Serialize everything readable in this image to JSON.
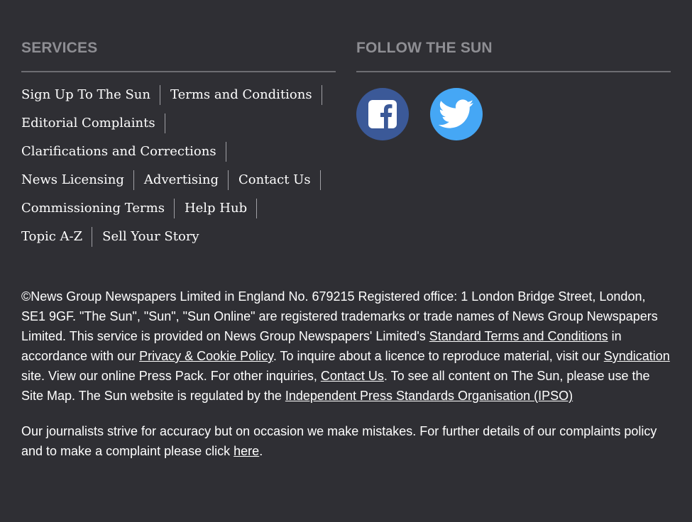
{
  "services": {
    "title": "SERVICES",
    "links": [
      "Sign Up To The Sun",
      "Terms and Conditions",
      "Editorial Complaints",
      "Clarifications and Corrections",
      "News Licensing",
      "Advertising",
      "Contact Us",
      "Commissioning Terms",
      "Help Hub",
      "Topic A-Z",
      "Sell Your Story"
    ]
  },
  "follow": {
    "title": "FOLLOW THE SUN",
    "facebook_icon": "facebook-icon",
    "twitter_icon": "twitter-icon",
    "facebook_color": "#3b5998",
    "twitter_color": "#45a7f5"
  },
  "legal": {
    "p1_part1": "©News Group Newspapers Limited in England No. 679215 Registered office: 1 London Bridge Street, London, SE1 9GF. \"The Sun\", \"Sun\", \"Sun Online\" are registered trademarks or trade names of News Group Newspapers Limited. This service is provided on News Group Newspapers' Limited's ",
    "link_terms": "Standard Terms and Conditions",
    "p1_part2": " in accordance with our ",
    "link_privacy": "Privacy & Cookie Policy",
    "p1_part3": ". To inquire about a licence to reproduce material, visit our ",
    "link_syndication": "Syndication",
    "p1_part4": " site. View our online Press Pack. For other inquiries, ",
    "link_contact": "Contact Us",
    "p1_part5": ". To see all content on The Sun, please use the Site Map. The Sun website is regulated by the ",
    "link_ipso": "Independent Press Standards Organisation (IPSO)",
    "p2_part1": "Our journalists strive for accuracy but on occasion we make mistakes. For further details of our complaints policy and to make a complaint please click ",
    "link_here": "here",
    "p2_part2": "."
  },
  "colors": {
    "background": "#2f2f34",
    "heading": "#8e8e93",
    "rule": "#6d6d72"
  }
}
